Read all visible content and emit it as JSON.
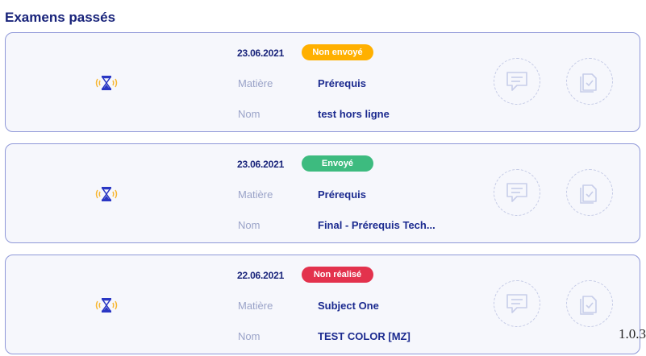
{
  "page": {
    "title": "Examens passés",
    "version": "1.0.3"
  },
  "labels": {
    "matiere": "Matière",
    "nom": "Nom"
  },
  "colors": {
    "sent": "#3dbb7f",
    "not_sent": "#ffb000",
    "not_done": "#e3324d",
    "primary": "#18237a"
  },
  "exams": [
    {
      "date": "23.06.2021",
      "status": "Non envoyé",
      "status_color": "#ffb000",
      "matiere": "Prérequis",
      "nom": "test hors ligne"
    },
    {
      "date": "23.06.2021",
      "status": "Envoyé",
      "status_color": "#3dbb7f",
      "matiere": "Prérequis",
      "nom": "Final - Prérequis Tech..."
    },
    {
      "date": "22.06.2021",
      "status": "Non réalisé",
      "status_color": "#e3324d",
      "matiere": "Subject One",
      "nom": "TEST COLOR [MZ]"
    }
  ],
  "icons": {
    "status": "hourglass-icon",
    "comment": "comment-icon",
    "report": "documents-check-icon"
  }
}
